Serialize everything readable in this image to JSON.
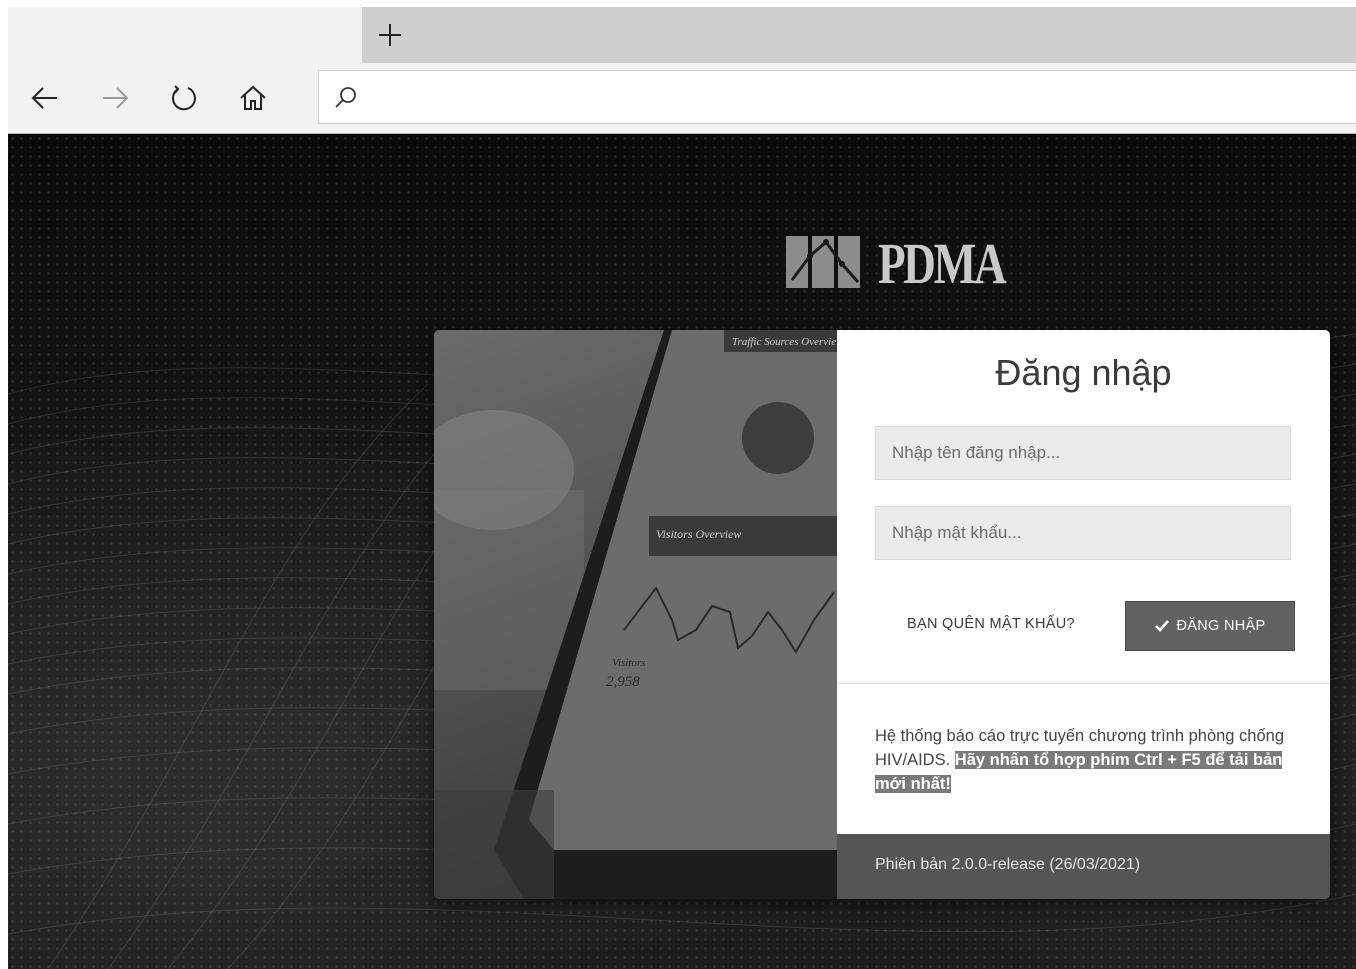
{
  "browser": {
    "new_tab_icon": "plus-icon",
    "back_icon": "arrow-left-icon",
    "forward_icon": "arrow-right-icon",
    "refresh_icon": "refresh-icon",
    "home_icon": "home-icon",
    "search_icon": "search-icon",
    "address_value": ""
  },
  "logo": {
    "text": "PDMA"
  },
  "login": {
    "title": "Đăng nhập",
    "username_placeholder": "Nhập tên đăng nhập...",
    "password_placeholder": "Nhập mật khẩu...",
    "forgot_label": "BẠN QUÊN MẬT KHẨU?",
    "submit_icon": "check-icon",
    "submit_label": "ĐĂNG NHẬP",
    "description": "Hệ thống báo cáo trực tuyến chương trình phòng chống HIV/AIDS.",
    "highlight": "Hãy nhấn tổ hợp phím Ctrl + F5 để tải bản mới nhất!",
    "version": "Phiên bản 2.0.0-release (26/03/2021)"
  },
  "tablet_image": {
    "header1": "Traffic Sources Overview",
    "header2": "Visitors Overview",
    "visitors_label": "Visitors",
    "visitors_value": "2,958"
  },
  "colors": {
    "button": "#626262",
    "footer": "#555555",
    "highlight": "#7a7a7a"
  }
}
